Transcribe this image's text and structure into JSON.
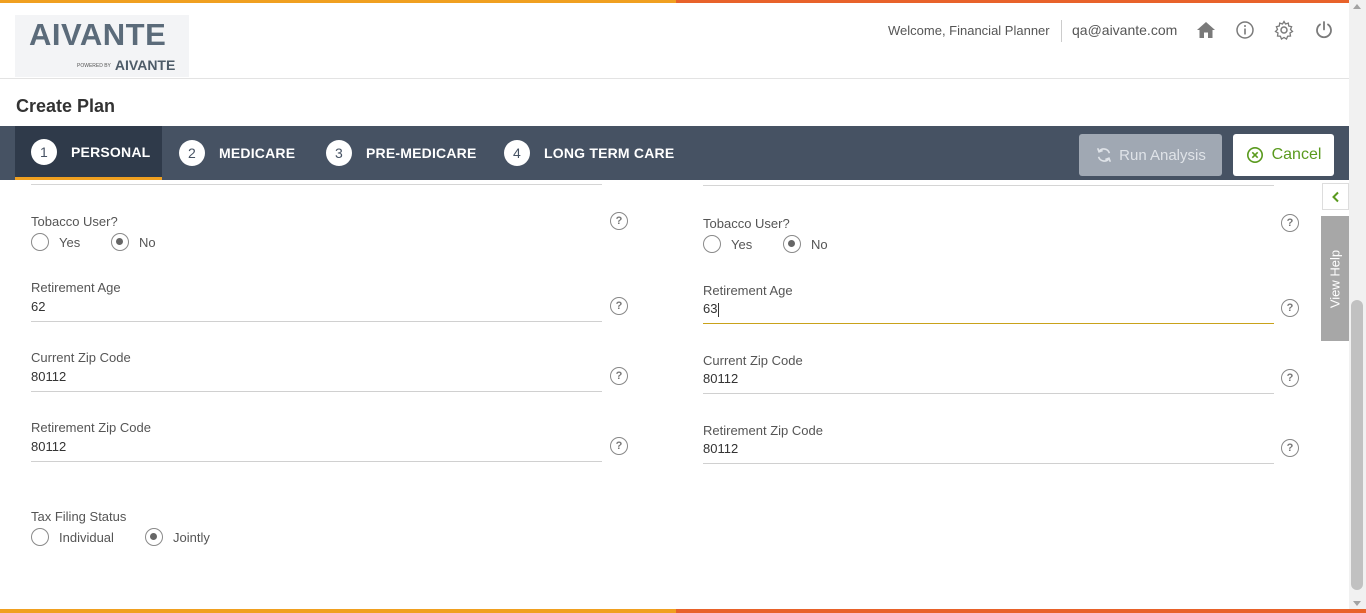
{
  "header": {
    "logo_text": "AIVANTE",
    "logo_sub_prefix": "POWERED BY",
    "logo_sub_brand": "AIVANTE",
    "welcome": "Welcome, Financial Planner",
    "email": "qa@aivante.com",
    "icons": [
      "home-icon",
      "info-icon",
      "gear-icon",
      "power-icon"
    ]
  },
  "page": {
    "title": "Create Plan"
  },
  "steps": [
    {
      "num": "1",
      "label": "PERSONAL",
      "active": true
    },
    {
      "num": "2",
      "label": "MEDICARE",
      "active": false
    },
    {
      "num": "3",
      "label": "PRE-MEDICARE",
      "active": false
    },
    {
      "num": "4",
      "label": "LONG TERM CARE",
      "active": false
    }
  ],
  "actions": {
    "run_label": "Run Analysis",
    "cancel_label": "Cancel"
  },
  "left": {
    "tobacco_label": "Tobacco User?",
    "tobacco_yes": "Yes",
    "tobacco_no": "No",
    "tobacco_selected": "No",
    "retirement_age_label": "Retirement Age",
    "retirement_age": "62",
    "current_zip_label": "Current Zip Code",
    "current_zip": "80112",
    "retirement_zip_label": "Retirement Zip Code",
    "retirement_zip": "80112",
    "tax_label": "Tax Filing Status",
    "tax_individual": "Individual",
    "tax_jointly": "Jointly",
    "tax_selected": "Jointly"
  },
  "right": {
    "tobacco_label": "Tobacco User?",
    "tobacco_yes": "Yes",
    "tobacco_no": "No",
    "tobacco_selected": "No",
    "retirement_age_label": "Retirement Age",
    "retirement_age": "63",
    "current_zip_label": "Current Zip Code",
    "current_zip": "80112",
    "retirement_zip_label": "Retirement Zip Code",
    "retirement_zip": "80112"
  },
  "help_glyph": "?",
  "side": {
    "view_help_label": "View Help"
  },
  "colors": {
    "accent_orange": "#f0a020",
    "accent_red": "#e8622a",
    "nav_bg": "#465263",
    "cancel_green": "#5a9a1e",
    "focus_line": "#c9a21a"
  }
}
